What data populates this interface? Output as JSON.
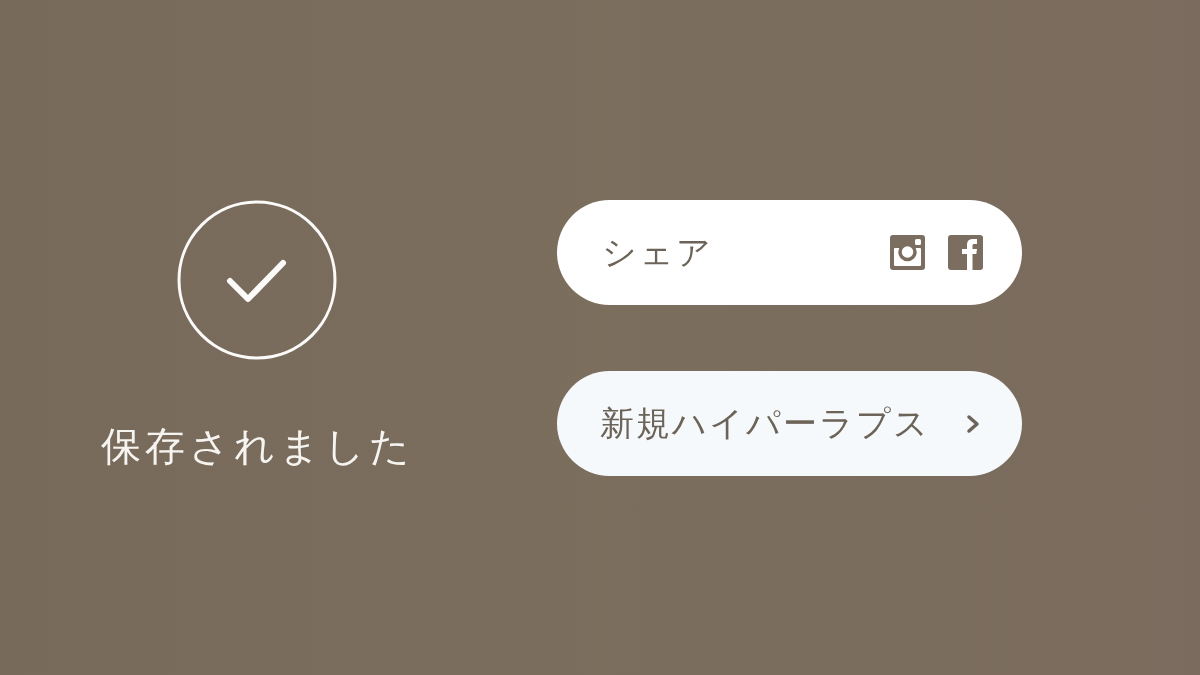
{
  "status": {
    "message": "保存されました"
  },
  "actions": [
    {
      "kind": "share",
      "label": "シェア"
    },
    {
      "kind": "link",
      "label": "新規ハイパーラプス"
    }
  ]
}
